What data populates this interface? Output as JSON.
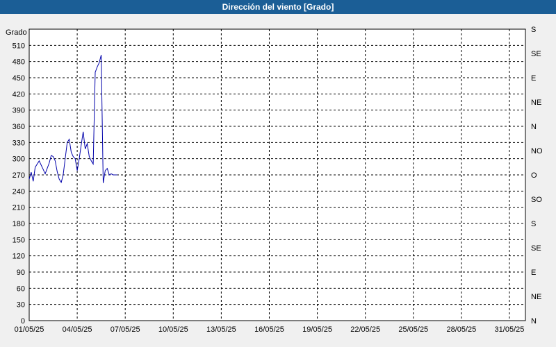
{
  "title": "Dirección del viento [Grado]",
  "colors": {
    "title_bg": "#1b5e96",
    "title_text": "#ffffff",
    "series": "#0000aa",
    "grid": "#000000",
    "background": "#f0f0f0"
  },
  "chart_data": {
    "type": "line",
    "title": "Dirección del viento [Grado]",
    "ylabel": "Grado",
    "xlabel": "",
    "ylim": [
      0,
      540
    ],
    "xlim": [
      "01/05/25",
      "01/06/25"
    ],
    "grid": true,
    "y_ticks": [
      0,
      30,
      60,
      90,
      120,
      150,
      180,
      210,
      240,
      270,
      300,
      330,
      360,
      390,
      420,
      450,
      480,
      510
    ],
    "x_ticks": [
      "01/05/25",
      "04/05/25",
      "07/05/25",
      "10/05/25",
      "13/05/25",
      "16/05/25",
      "19/05/25",
      "22/05/25",
      "25/05/25",
      "28/05/25",
      "31/05/25"
    ],
    "right_ticks": [
      {
        "label": "N",
        "value": 0
      },
      {
        "label": "NE",
        "value": 45
      },
      {
        "label": "E",
        "value": 90
      },
      {
        "label": "SE",
        "value": 135
      },
      {
        "label": "S",
        "value": 180
      },
      {
        "label": "SO",
        "value": 225
      },
      {
        "label": "O",
        "value": 270
      },
      {
        "label": "NO",
        "value": 315
      },
      {
        "label": "N",
        "value": 360
      },
      {
        "label": "NE",
        "value": 405
      },
      {
        "label": "E",
        "value": 450
      },
      {
        "label": "SE",
        "value": 495
      },
      {
        "label": "S",
        "value": 540
      }
    ],
    "series": [
      {
        "x": [
          "01/05/25 00:00",
          "01/05/25 03:00",
          "01/05/25 06:00",
          "01/05/25 09:00",
          "01/05/25 12:00",
          "01/05/25 15:00",
          "01/05/25 18:00",
          "01/05/25 21:00",
          "02/05/25 00:00",
          "02/05/25 03:00",
          "02/05/25 06:00",
          "02/05/25 09:00",
          "02/05/25 12:00",
          "02/05/25 15:00",
          "02/05/25 18:00",
          "02/05/25 21:00",
          "03/05/25 00:00",
          "03/05/25 03:00",
          "03/05/25 06:00",
          "03/05/25 09:00",
          "03/05/25 12:00",
          "03/05/25 15:00",
          "03/05/25 18:00",
          "03/05/25 21:00",
          "04/05/25 00:00",
          "04/05/25 03:00",
          "04/05/25 06:00",
          "04/05/25 09:00",
          "04/05/25 12:00",
          "04/05/25 15:00",
          "04/05/25 18:00",
          "04/05/25 21:00",
          "05/05/25 00:00",
          "05/05/25 03:00",
          "05/05/25 06:00",
          "05/05/25 09:00",
          "05/05/25 12:00",
          "05/05/25 15:00",
          "05/05/25 18:00",
          "05/05/25 21:00",
          "06/05/25 00:00",
          "06/05/25 03:00",
          "06/05/25 06:00",
          "06/05/25 09:00",
          "06/05/25 12:00"
        ],
        "values": [
          262,
          275,
          258,
          284,
          290,
          296,
          288,
          280,
          272,
          282,
          292,
          306,
          304,
          296,
          276,
          262,
          256,
          270,
          300,
          330,
          336,
          312,
          304,
          300,
          278,
          300,
          326,
          350,
          318,
          328,
          304,
          296,
          290,
          460,
          470,
          478,
          492,
          255,
          278,
          282,
          270,
          272,
          270,
          270,
          270
        ]
      }
    ]
  }
}
